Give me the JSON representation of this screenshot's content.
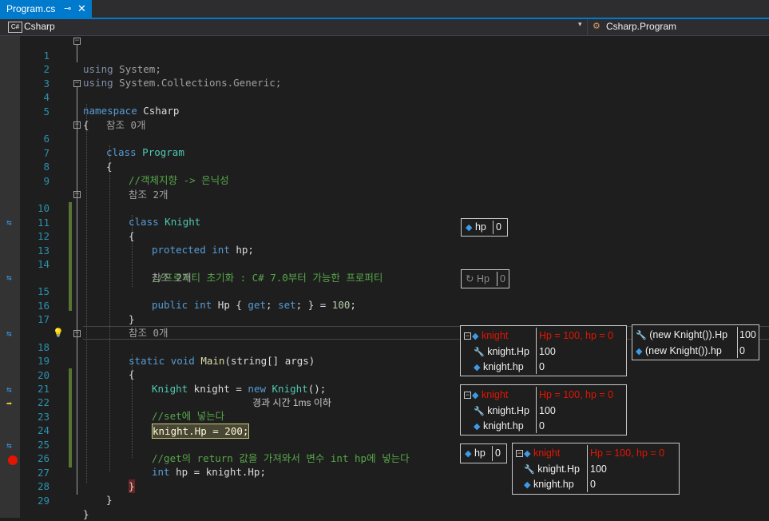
{
  "tab": {
    "title": "Program.cs",
    "pin": "⊸",
    "close": "✕"
  },
  "nav": {
    "project": "Csharp",
    "project_icon": "C#",
    "member": "Csharp.Program",
    "dropdown": "▾"
  },
  "lines": {
    "l1": {
      "n": "1",
      "kw": "using",
      "rest": " System;"
    },
    "l2": {
      "n": "2",
      "kw": "using",
      "rest": " System.Collections.Generic;"
    },
    "l3": {
      "n": "3"
    },
    "l4": {
      "n": "4",
      "kw": "namespace",
      "rest": " Csharp"
    },
    "l5": {
      "n": "5",
      "text": "{"
    },
    "ref_program": "참조 0개",
    "l6": {
      "n": "6",
      "kw": "class",
      "name": "Program"
    },
    "l7": {
      "n": "7",
      "text": "{"
    },
    "l8": {
      "n": "8",
      "comment": "//객체지향 -> 은닉성"
    },
    "l9": {
      "n": "9"
    },
    "ref_knight": "참조 2개",
    "l10": {
      "n": "10",
      "kw": "class",
      "name": "Knight"
    },
    "l11": {
      "n": "11",
      "text": "{"
    },
    "l12": {
      "n": "12",
      "kw1": "protected",
      "kw2": "int",
      "rest": " hp;"
    },
    "l13": {
      "n": "13"
    },
    "l14": {
      "n": "14",
      "comment": "//프로퍼티 초기화 : C# 7.0부터 가능한 프로퍼티"
    },
    "ref_hp": "참조 2개",
    "l15": {
      "n": "15",
      "kw1": "public",
      "kw2": "int",
      "mid": " Hp { ",
      "get": "get",
      "semi1": "; ",
      "set": "set",
      "semi2": "; } = ",
      "num": "100",
      "end": ";"
    },
    "l16": {
      "n": "16",
      "text": "}"
    },
    "l17": {
      "n": "17"
    },
    "ref_main": "참조 0개",
    "l18": {
      "n": "18",
      "kw1": "static",
      "kw2": "void",
      "method": "Main",
      "params": "(string[] args)"
    },
    "l19": {
      "n": "19",
      "text": "{"
    },
    "l20": {
      "n": "20",
      "type": "Knight",
      "mid": " knight = ",
      "new": "new",
      "type2": "Knight",
      "end": "();"
    },
    "l21": {
      "n": "21"
    },
    "l22": {
      "n": "22",
      "comment": "//set에 넣는다"
    },
    "l23": {
      "n": "23",
      "stmt": "knight.Hp = 200;",
      "elapsed": "경과 시간 1ms 이하"
    },
    "l24": {
      "n": "24"
    },
    "l25": {
      "n": "25",
      "comment": "//get의 return 값을 가져와서 변수 int hp에 넣는다"
    },
    "l26": {
      "n": "26",
      "kw": "int",
      "rest": " hp = knight.Hp;"
    },
    "l27": {
      "n": "27",
      "text": "}"
    },
    "l28": {
      "n": "28",
      "text": "}"
    },
    "l29": {
      "n": "29",
      "text": "}"
    }
  },
  "datatips": {
    "hp1": {
      "name": "hp",
      "value": "0"
    },
    "Hp15": {
      "name": "Hp",
      "value": "0"
    },
    "knight1": {
      "name": "knight",
      "value": "Hp = 100, hp = 0",
      "r1n": "knight.Hp",
      "r1v": "100",
      "r2n": "knight.hp",
      "r2v": "0"
    },
    "newknight": {
      "r1n": "(new Knight()).Hp",
      "r1v": "100",
      "r2n": "(new Knight()).hp",
      "r2v": "0"
    },
    "knight2": {
      "name": "knight",
      "value": "Hp = 100, hp = 0",
      "r1n": "knight.Hp",
      "r1v": "100",
      "r2n": "knight.hp",
      "r2v": "0"
    },
    "hp2": {
      "name": "hp",
      "value": "0"
    },
    "knight3": {
      "name": "knight",
      "value": "Hp = 100, hp = 0",
      "r1n": "knight.Hp",
      "r1v": "100",
      "r2n": "knight.hp",
      "r2v": "0"
    }
  }
}
